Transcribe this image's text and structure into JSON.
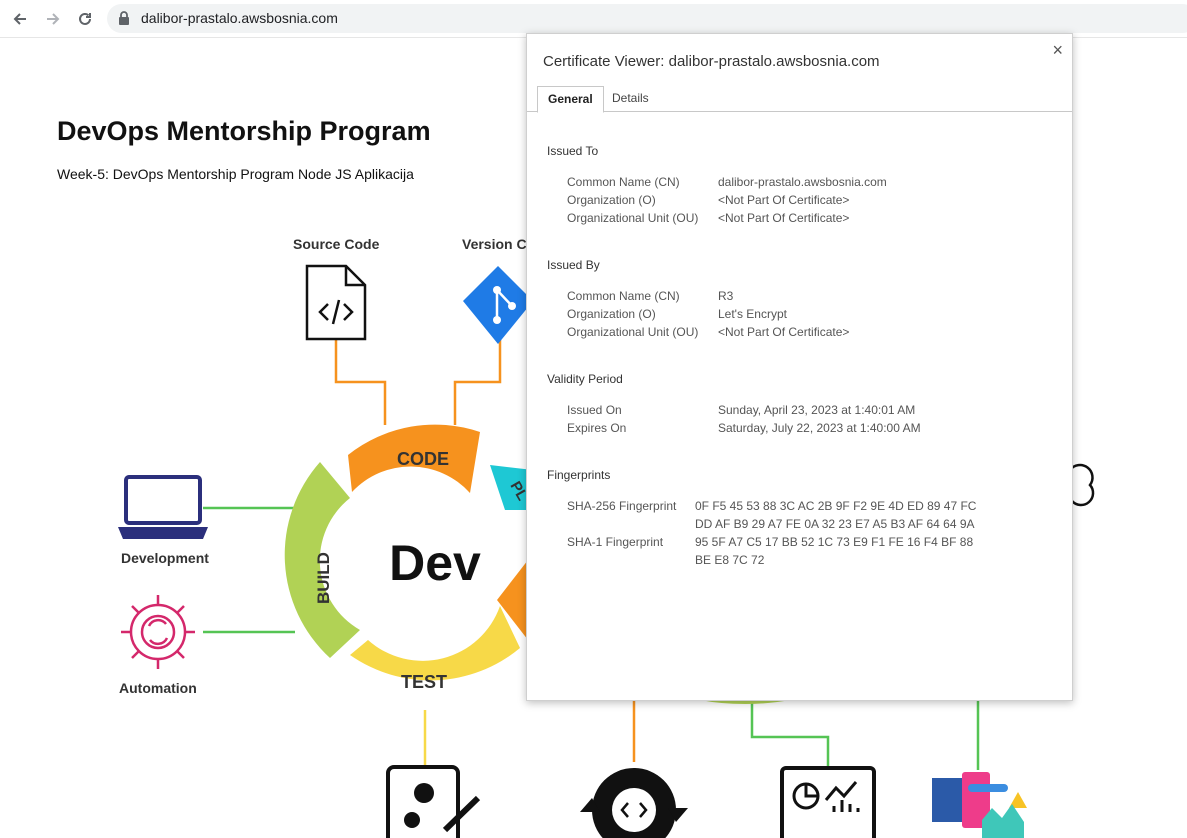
{
  "browser": {
    "url": "dalibor-prastalo.awsbosnia.com",
    "back_icon": "arrow-left-icon",
    "forward_icon": "arrow-right-icon",
    "reload_icon": "reload-icon",
    "lock_icon": "lock-icon"
  },
  "page": {
    "title": "DevOps Mentorship Program",
    "subtitle": "Week-5: DevOps Mentorship Program Node JS Aplikacija"
  },
  "diagram": {
    "labels": {
      "source_code": "Source Code",
      "version_control": "Version C",
      "development": "Development",
      "automation": "Automation",
      "center": "Dev",
      "code": "CODE",
      "build": "BUILD",
      "test": "TEST",
      "plan": "PL"
    },
    "colors": {
      "orange": "#f6921e",
      "yellow": "#f7d948",
      "green": "#b1d255",
      "teal": "#1ec8d4",
      "line_green": "#55c454",
      "git_blue": "#1f7be6",
      "navy": "#2b2f7c",
      "magenta": "#d4286b"
    }
  },
  "dialog": {
    "title": "Certificate Viewer: dalibor-prastalo.awsbosnia.com",
    "close_label": "×",
    "tabs": [
      "General",
      "Details"
    ],
    "issued_to": {
      "heading": "Issued To",
      "rows": [
        {
          "key": "Common Name (CN)",
          "value": "dalibor-prastalo.awsbosnia.com"
        },
        {
          "key": "Organization (O)",
          "value": "<Not Part Of Certificate>"
        },
        {
          "key": "Organizational Unit (OU)",
          "value": "<Not Part Of Certificate>"
        }
      ]
    },
    "issued_by": {
      "heading": "Issued By",
      "rows": [
        {
          "key": "Common Name (CN)",
          "value": "R3"
        },
        {
          "key": "Organization (O)",
          "value": "Let's Encrypt"
        },
        {
          "key": "Organizational Unit (OU)",
          "value": "<Not Part Of Certificate>"
        }
      ]
    },
    "validity": {
      "heading": "Validity Period",
      "rows": [
        {
          "key": "Issued On",
          "value": "Sunday, April 23, 2023 at 1:40:01 AM"
        },
        {
          "key": "Expires On",
          "value": "Saturday, July 22, 2023 at 1:40:00 AM"
        }
      ]
    },
    "fingerprints": {
      "heading": "Fingerprints",
      "sha256_key": "SHA-256 Fingerprint",
      "sha256_line1": "0F F5 45 53 88 3C AC 2B 9F F2 9E 4D ED 89 47 FC",
      "sha256_line2": "DD AF B9 29 A7 FE 0A 32 23 E7 A5 B3 AF 64 64 9A",
      "sha1_key": "SHA-1 Fingerprint",
      "sha1_line1": "95 5F A7 C5 17 BB 52 1C 73 E9 F1 FE 16 F4 BF 88",
      "sha1_line2": "BE E8 7C 72"
    }
  }
}
